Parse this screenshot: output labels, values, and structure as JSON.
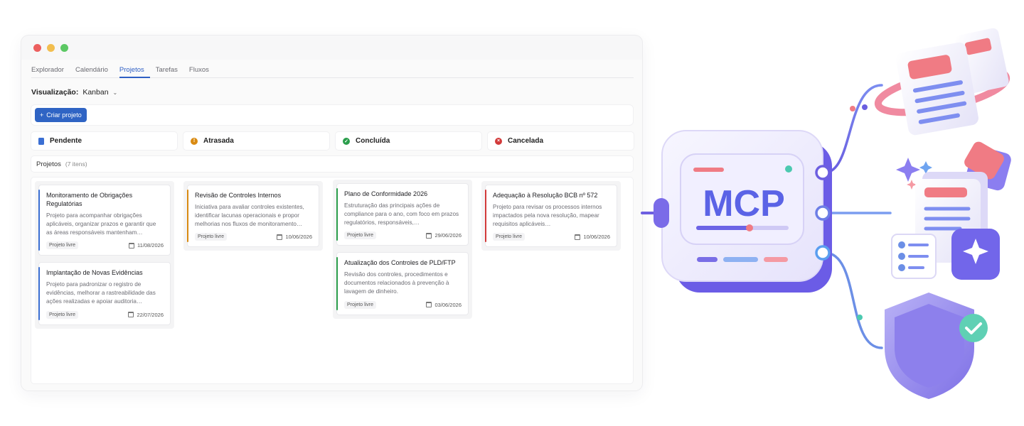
{
  "tabs": [
    "Explorador",
    "Calendário",
    "Projetos",
    "Tarefas",
    "Fluxos"
  ],
  "active_tab": "Projetos",
  "view": {
    "label": "Visualização:",
    "value": "Kanban"
  },
  "toolbar": {
    "create_label": "Criar projeto"
  },
  "statuses": [
    {
      "label": "Pendente",
      "icon": "document-icon"
    },
    {
      "label": "Atrasada",
      "icon": "warning-icon"
    },
    {
      "label": "Concluída",
      "icon": "check-icon"
    },
    {
      "label": "Cancelada",
      "icon": "cancel-icon"
    }
  ],
  "projects": {
    "label": "Projetos",
    "count": "(7 itens)"
  },
  "columns": [
    [
      {
        "title": "Monitoramento de Obrigações Regulatórias",
        "desc": "Projeto para acompanhar obrigações aplicáveis, organizar prazos e garantir que as áreas responsáveis mantenham…",
        "tag": "Projeto livre",
        "date": "11/08/2026",
        "accent": "#3b6fd3"
      },
      {
        "title": "Implantação de Novas Evidências",
        "desc": "Projeto para padronizar o registro de evidências, melhorar a rastreabilidade das ações realizadas e apoiar auditoria…",
        "tag": "Projeto livre",
        "date": "22/07/2026",
        "accent": "#3b6fd3"
      }
    ],
    [
      {
        "title": "Revisão de Controles Internos",
        "desc": "Iniciativa para avaliar controles existentes, identificar lacunas operacionais e propor melhorias nos fluxos de monitoramento…",
        "tag": "Projeto livre",
        "date": "10/06/2026",
        "accent": "#d98a12"
      }
    ],
    [
      {
        "title": "Plano de Conformidade 2026",
        "desc": "Estruturação das principais ações de compliance para o ano, com foco em prazos regulatórios, responsáveis,…",
        "tag": "Projeto livre",
        "date": "29/06/2026",
        "accent": "#2a9d4b"
      },
      {
        "title": "Atualização dos Controles de PLD/FTP",
        "desc": "Revisão dos controles, procedimentos e documentos relacionados à prevenção à lavagem de dinheiro.",
        "tag": "Projeto livre",
        "date": "03/06/2026",
        "accent": "#2a9d4b"
      }
    ],
    [
      {
        "title": "Adequação à Resolução BCB nº 572",
        "desc": "Projeto para revisar os processos internos impactados pela nova resolução, mapear requisitos aplicáveis…",
        "tag": "Projeto livre",
        "date": "10/06/2026",
        "accent": "#d23a3a"
      }
    ]
  ],
  "mcp_label": "MCP",
  "colors": {
    "primary": "#2f64c4",
    "mcp": "#5b63e6",
    "purple": "#8a7ef0",
    "coral": "#f07b84",
    "teal": "#4cc9b0"
  }
}
